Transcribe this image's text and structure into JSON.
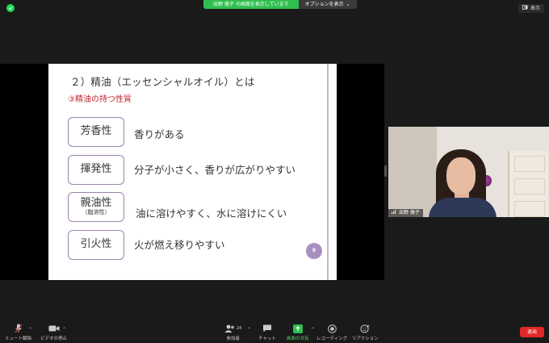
{
  "topbar": {
    "share_banner": "出野 倫子 の画面を表示しています",
    "options_label": "オプションを表示",
    "view_label": "表示"
  },
  "slide": {
    "title": "２）精油（エッセンシャルオイル）とは",
    "subtitle": "③精油の持つ性質",
    "page_number": "8",
    "items": [
      {
        "term": "芳香性",
        "note": "",
        "description": "香りがある"
      },
      {
        "term": "揮発性",
        "note": "",
        "description": "分子が小さく、香りが広がりやすい"
      },
      {
        "term": "親油性",
        "note": "（脂溶性）",
        "description": "油に溶けやすく、水に溶けにくい"
      },
      {
        "term": "引火性",
        "note": "",
        "description": "火が燃え移りやすい"
      }
    ]
  },
  "video": {
    "participant_name": "出野 倫子"
  },
  "toolbar": {
    "mute_label": "ミュート解除",
    "video_label": "ビデオの停止",
    "participants_label": "参加者",
    "participants_count": "24",
    "chat_label": "チャット",
    "share_label": "画面の共有",
    "record_label": "レコーディング",
    "reactions_label": "リアクション",
    "leave_label": "退出"
  },
  "colors": {
    "green_share": "#2fbf50",
    "slide_accent": "#9d82ad",
    "slide_red": "#c0282e",
    "leave_red": "#e02828"
  }
}
